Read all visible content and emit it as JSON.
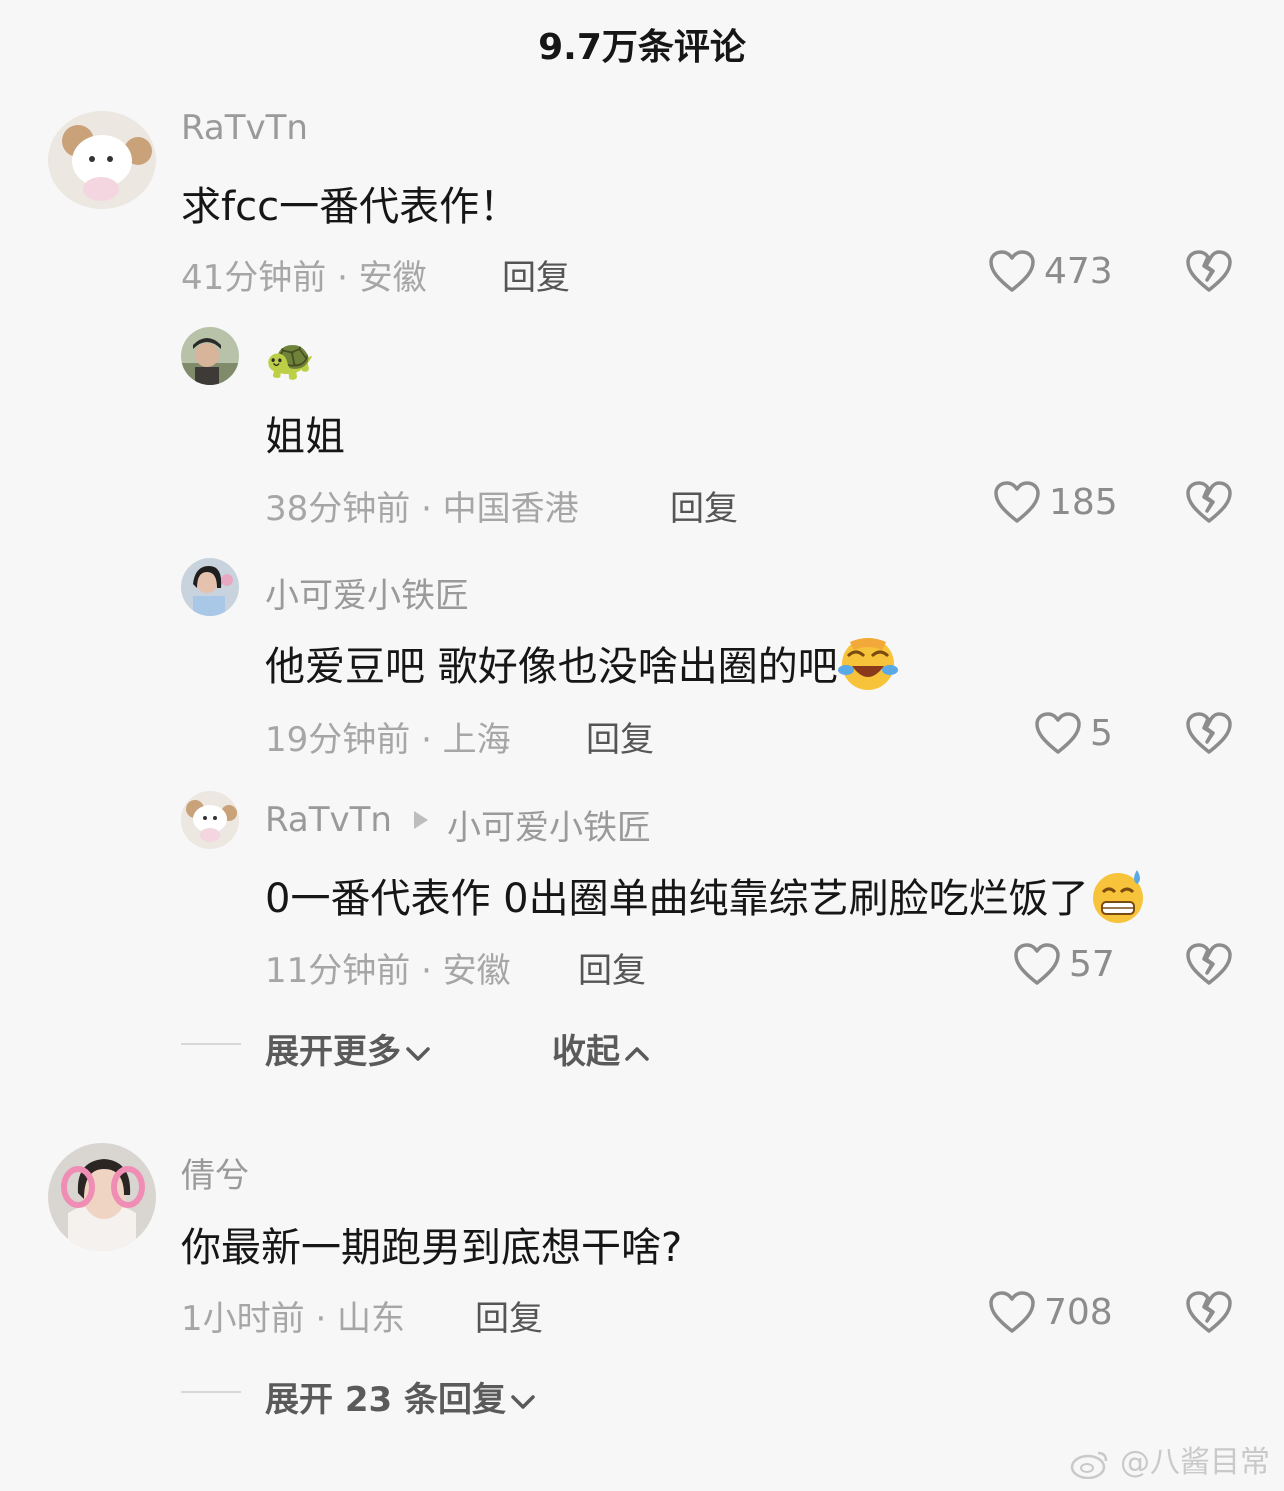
{
  "header": {
    "title": "9.7万条评论"
  },
  "comments": [
    {
      "username": "RaTvTn",
      "content": "求fcc一番代表作！",
      "meta": "41分钟前 · 安徽",
      "reply_label": "回复",
      "likes": "473",
      "replies": [
        {
          "username": "🐢",
          "content": "姐姐",
          "meta": "38分钟前 · 中国香港",
          "reply_label": "回复",
          "likes": "185"
        },
        {
          "username": "小可爱小铁匠",
          "content": "他爱豆吧 歌好像也没啥出圈的吧",
          "meta": "19分钟前 · 上海",
          "reply_label": "回复",
          "likes": "5",
          "emoji": "laughing-crying-emoji"
        },
        {
          "username": "RaTvTn",
          "reply_to": "小可爱小铁匠",
          "content": "0一番代表作 0出圈单曲纯靠综艺刷脸吃烂饭了",
          "meta": "11分钟前 · 安徽",
          "reply_label": "回复",
          "likes": "57",
          "emoji": "grimacing-sweat-emoji"
        }
      ],
      "expand_more_label": "展开更多",
      "collapse_label": "收起"
    },
    {
      "username": "倩兮",
      "content": "你最新一期跑男到底想干啥?",
      "meta": "1小时前 · 山东",
      "reply_label": "回复",
      "likes": "708",
      "expand_replies_label": "展开 23 条回复"
    }
  ],
  "watermark": "@八酱目常",
  "colors": {
    "background": "#f7f7f7",
    "text": "#161616",
    "muted": "#a6a6a6"
  }
}
